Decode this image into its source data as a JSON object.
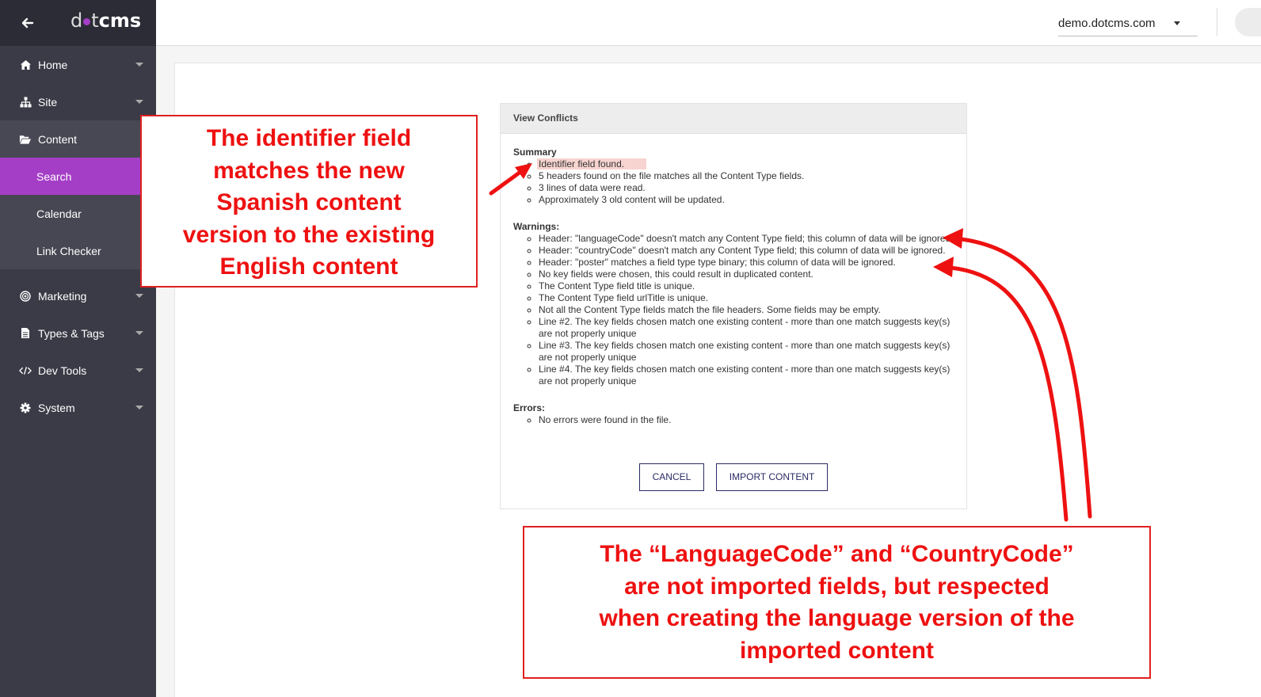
{
  "logo": {
    "text_thin": "d",
    "text_mid": "t",
    "text_bold": "cms"
  },
  "sidebar": {
    "items": [
      {
        "label": "Home",
        "icon": "home-icon"
      },
      {
        "label": "Site",
        "icon": "sitemap-icon"
      },
      {
        "label": "Content",
        "icon": "folder-open-icon",
        "children": [
          {
            "label": "Search"
          },
          {
            "label": "Calendar"
          },
          {
            "label": "Link Checker"
          }
        ]
      },
      {
        "label": "Marketing",
        "icon": "bullseye-icon"
      },
      {
        "label": "Types & Tags",
        "icon": "file-icon"
      },
      {
        "label": "Dev Tools",
        "icon": "code-icon"
      },
      {
        "label": "System",
        "icon": "gear-icon"
      }
    ]
  },
  "header": {
    "site": "demo.dotcms.com"
  },
  "dialog": {
    "title": "View Conflicts",
    "summary_title": "Summary",
    "summary": [
      "Identifier field found.",
      "5 headers found on the file matches all the Content Type fields.",
      "3 lines of data were read.",
      "Approximately 3 old content will be updated."
    ],
    "warnings_title": "Warnings:",
    "warnings": [
      "Header: \"languageCode\" doesn't match any Content Type field; this column of data will be ignored.",
      "Header: \"countryCode\" doesn't match any Content Type field; this column of data will be ignored.",
      "Header: \"poster\" matches a field type type binary; this column of data will be ignored.",
      "No key fields were chosen, this could result in duplicated content.",
      "The Content Type field title is unique.",
      "The Content Type field urlTitle is unique.",
      "Not all the Content Type fields match the file headers. Some fields may be empty.",
      "Line #2. The key fields chosen match one existing content - more than one match suggests key(s) are not properly unique",
      "Line #3. The key fields chosen match one existing content - more than one match suggests key(s) are not properly unique",
      "Line #4. The key fields chosen match one existing content - more than one match suggests key(s) are not properly unique"
    ],
    "errors_title": "Errors:",
    "errors": [
      "No errors were found in the file."
    ],
    "cancel_label": "CANCEL",
    "import_label": "IMPORT CONTENT"
  },
  "annotations": {
    "callout1": [
      "The identifier field",
      "matches the new",
      "Spanish content",
      "version to the existing",
      "English content"
    ],
    "callout2": [
      "The “LanguageCode” and “CountryCode”",
      "are not imported fields, but respected",
      "when creating the language version of the",
      "imported content"
    ]
  },
  "colors": {
    "accent": "#a53ec7",
    "annotation_red": "#ee1111",
    "sidebar_bg": "#3b3b47"
  }
}
